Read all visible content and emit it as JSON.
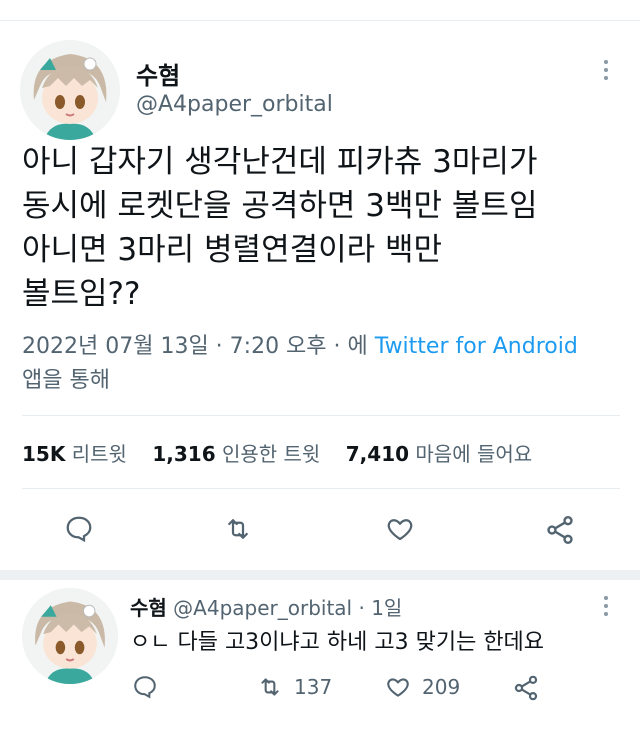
{
  "main_tweet": {
    "author_name": "수혐",
    "handle": "@A4paper_orbital",
    "text_lines": [
      "아니 갑자기 생각난건데 피카츄 3마리가",
      "동시에 로켓단을 공격하면 3백만 볼트임",
      "아니면 3마리 병렬연결이라 백만",
      "볼트임??"
    ],
    "timestamp": "2022년 07월 13일 · 7:20 오후 · 에",
    "source": "Twitter for Android",
    "source_suffix": "앱을 통해",
    "stats": {
      "retweets_count": "15K",
      "retweets_label": "리트윗",
      "quotes_count": "1,316",
      "quotes_label": "인용한 트윗",
      "likes_count": "7,410",
      "likes_label": "마음에 들어요"
    }
  },
  "reply": {
    "author_name": "수혐",
    "handle": "@A4paper_orbital",
    "time": "· 1일",
    "text": "ㅇㄴ 다들 고3이냐고 하네 고3 맞기는 한데요",
    "retweet_count": "137",
    "like_count": "209"
  },
  "colors": {
    "accent": "#1d9bf0",
    "secondary_text": "#536471",
    "divider": "#e6ecf0"
  },
  "icons": [
    "reply-icon",
    "retweet-icon",
    "like-icon",
    "share-icon",
    "more-icon"
  ]
}
